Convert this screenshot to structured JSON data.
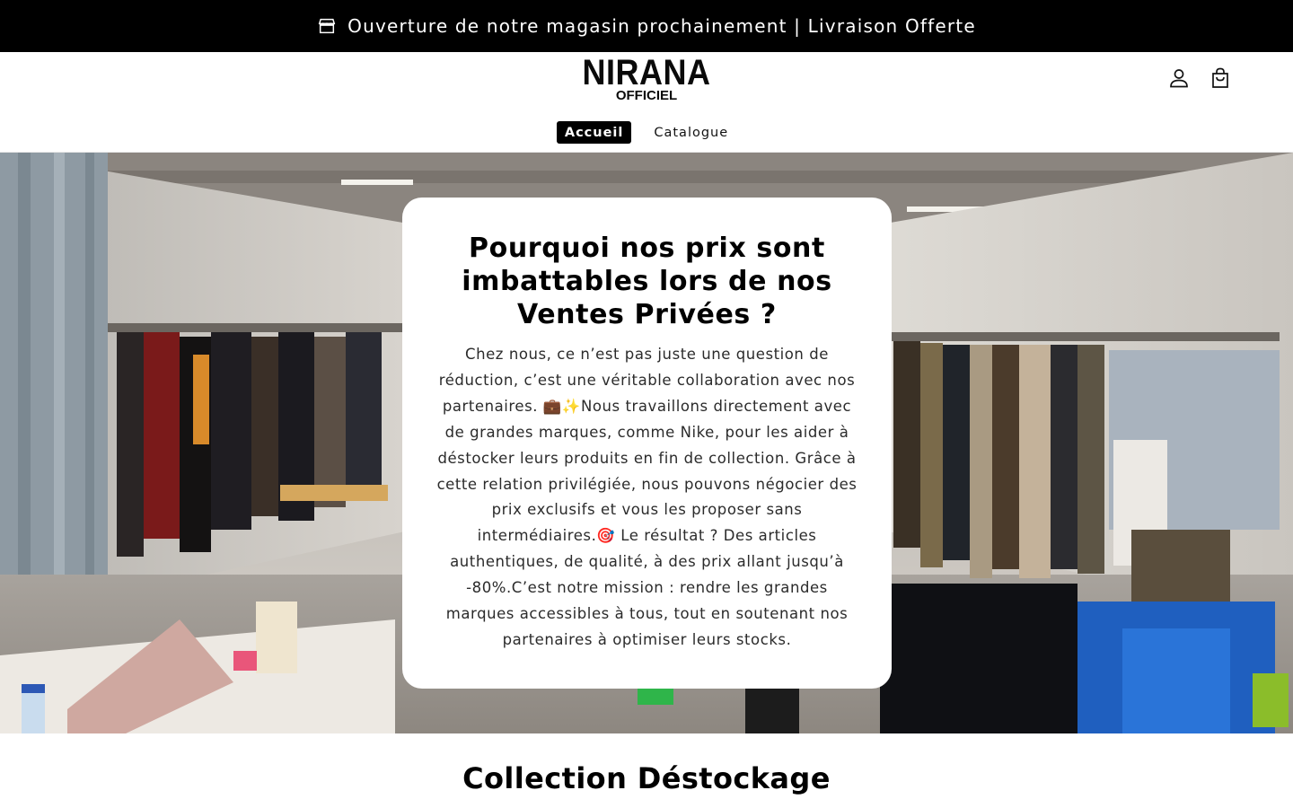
{
  "announcement": {
    "icon": "store-icon",
    "text": "Ouverture de notre magasin prochainement | Livraison Offerte"
  },
  "header": {
    "logo": {
      "main": "NIRANA",
      "sub": "OFFICIEL"
    },
    "icons": [
      "account-icon",
      "cart-icon"
    ],
    "nav": [
      {
        "label": "Accueil",
        "active": true
      },
      {
        "label": "Catalogue",
        "active": false
      }
    ]
  },
  "hero": {
    "title": "Pourquoi nos prix sont imbattables lors de nos Ventes Privées ?",
    "body": "Chez nous, ce n’est pas juste une question de réduction, c’est une véritable collaboration avec nos partenaires. 💼✨Nous travaillons directement avec de grandes marques, comme Nike, pour les aider à déstocker leurs produits en fin de collection. Grâce à cette relation privilégiée, nous pouvons négocier des prix exclusifs et vous les proposer sans intermédiaires.🎯 Le résultat ? Des articles authentiques, de qualité, à des prix allant jusqu’à -80%.C’est notre mission : rendre les grandes marques accessibles à tous, tout en soutenant nos partenaires à optimiser leurs stocks."
  },
  "collection": {
    "title": "Collection Déstockage"
  },
  "colors": {
    "announcement_bg": "#000000",
    "nav_active_bg": "#000000",
    "card_bg": "#ffffff"
  }
}
